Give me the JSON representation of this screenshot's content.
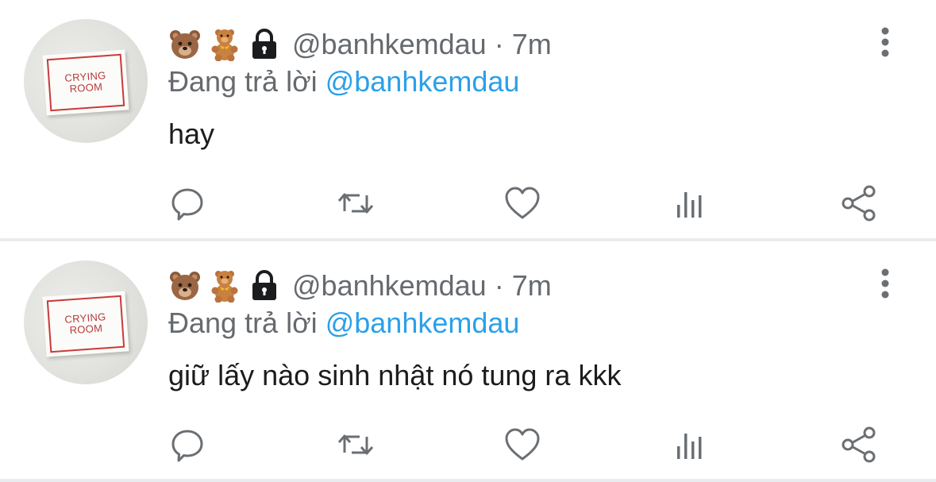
{
  "colors": {
    "muted": "#666a6e",
    "mention": "#2ba0e9",
    "text": "#1b1c1e",
    "divider": "#e9ecef",
    "icon": "#6b6f73"
  },
  "tweets": [
    {
      "avatar_sign": {
        "line1": "CRYING",
        "line2": "ROOM"
      },
      "emojis": [
        "bear-face-icon",
        "teddy-bear-icon",
        "lock-icon"
      ],
      "handle": "@banhkemdau",
      "separator": "·",
      "time": "7m",
      "reply_prefix": "Đang trả lời",
      "reply_to": "@banhkemdau",
      "text": "hay"
    },
    {
      "avatar_sign": {
        "line1": "CRYING",
        "line2": "ROOM"
      },
      "emojis": [
        "bear-face-icon",
        "teddy-bear-icon",
        "lock-icon"
      ],
      "handle": "@banhkemdau",
      "separator": "·",
      "time": "7m",
      "reply_prefix": "Đang trả lời",
      "reply_to": "@banhkemdau",
      "text": "giữ lấy nào sinh nhật nó tung ra kkk"
    }
  ],
  "actions": [
    "reply-icon",
    "retweet-icon",
    "like-icon",
    "stats-icon",
    "share-icon"
  ]
}
